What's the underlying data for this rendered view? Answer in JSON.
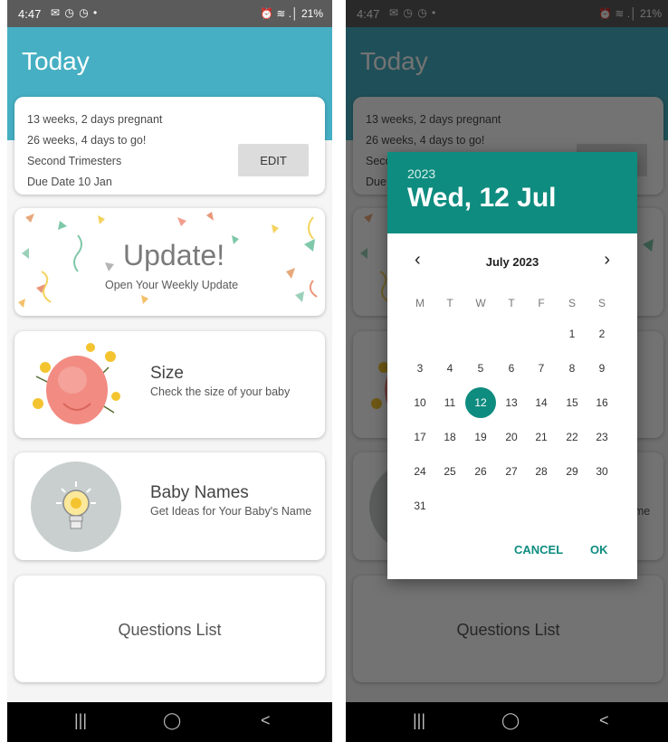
{
  "status_bar": {
    "time": "4:47",
    "icons": "✉ ◷ ◷ •",
    "right": "⏰ ≋ .│ 21%"
  },
  "app_bar": {
    "title": "Today"
  },
  "pregnancy_card": {
    "lines": [
      "13 weeks, 2 days pregnant",
      "26 weeks, 4 days to go!",
      "Second Trimesters",
      "Due Date 10 Jan"
    ],
    "edit_label": "EDIT"
  },
  "update_card": {
    "title": "Update!",
    "subtitle": "Open Your Weekly Update"
  },
  "size_card": {
    "title": "Size",
    "subtitle": "Check the size of your baby"
  },
  "names_card": {
    "title": "Baby Names",
    "subtitle": "Get Ideas for Your Baby's Name"
  },
  "questions_card": {
    "title": "Questions List"
  },
  "nav_bar": {
    "recents": "|||",
    "home": "◯",
    "back": "<"
  },
  "date_picker": {
    "year": "2023",
    "date": "Wed, 12 Jul",
    "month_label": "July 2023",
    "weekdays": [
      "M",
      "T",
      "W",
      "T",
      "F",
      "S",
      "S"
    ],
    "days": [
      "1",
      "2",
      "3",
      "4",
      "5",
      "6",
      "7",
      "8",
      "9",
      "10",
      "11",
      "12",
      "13",
      "14",
      "15",
      "16",
      "17",
      "18",
      "19",
      "20",
      "21",
      "22",
      "23",
      "24",
      "25",
      "26",
      "27",
      "28",
      "29",
      "30",
      "31"
    ],
    "first_day_column": 5,
    "selected_day": "12",
    "cancel_label": "CANCEL",
    "ok_label": "OK"
  },
  "colors": {
    "app_bar": "#46afc3",
    "dialog_accent": "#0e8c7f",
    "status_bar": "#5b5b5b"
  }
}
